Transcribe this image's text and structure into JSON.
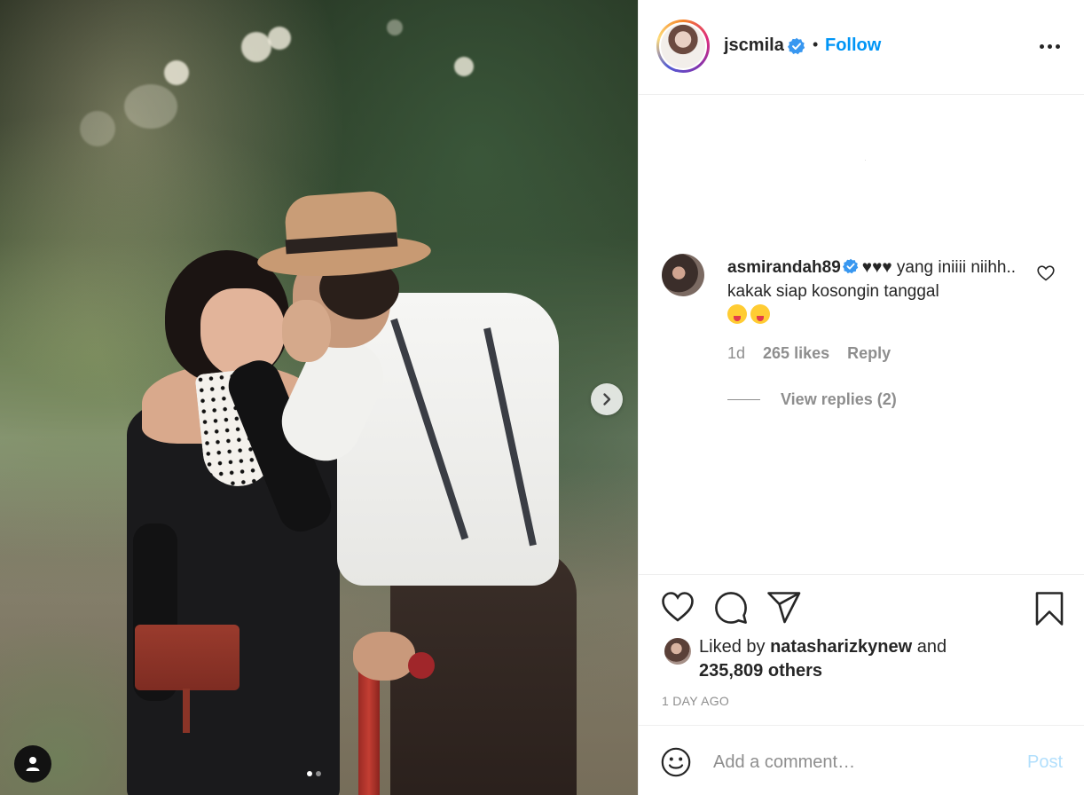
{
  "post": {
    "author": {
      "username": "jscmila",
      "verified": true,
      "follow_label": "Follow",
      "separator": "•"
    },
    "more_options_icon": "ellipsis-icon",
    "carousel": {
      "slide_count": 2,
      "active_index": 0,
      "next_icon": "chevron-right-icon"
    },
    "tag_icon": "user-tag-icon"
  },
  "comments": [
    {
      "username": "asmirandah89",
      "verified": true,
      "hearts": "♥♥♥",
      "text": " yang iniiii niihh.. kakak siap kosongin tanggal",
      "emojis": [
        "face-with-tongue",
        "squinting-face-with-tongue"
      ],
      "age": "1d",
      "likes": "265 likes",
      "reply_label": "Reply",
      "view_replies": "View replies (2)"
    }
  ],
  "actions": {
    "like_icon": "heart-icon",
    "comment_icon": "comment-icon",
    "share_icon": "paper-plane-icon",
    "save_icon": "bookmark-icon"
  },
  "likes": {
    "prefix": "Liked by ",
    "liker": "natasharizkynew",
    "connector": " and",
    "others": "235,809 others"
  },
  "timestamp": "1 DAY AGO",
  "add_comment": {
    "placeholder": "Add a comment…",
    "post_label": "Post"
  },
  "colors": {
    "follow_blue": "#0095f6",
    "post_disabled": "#b2dffc",
    "verified_blue": "#3897f0",
    "muted": "#8e8e8e"
  }
}
